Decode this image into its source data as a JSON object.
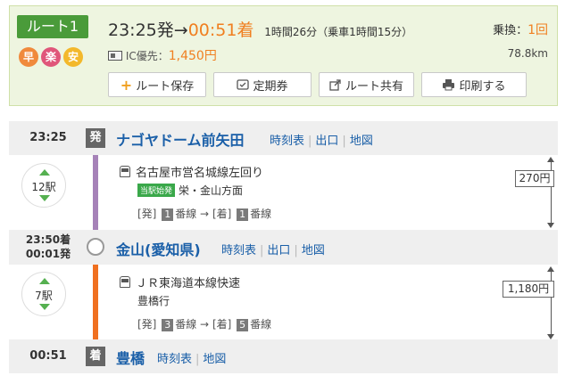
{
  "summary": {
    "route_label": "ルート1",
    "features": [
      "早",
      "楽",
      "安"
    ],
    "departure": "23:25発",
    "arrow": "→",
    "arrival": "00:51着",
    "duration": "1時間26分（乗車1時間15分）",
    "ic_label": "IC優先：",
    "fare": "1,450円",
    "transfer_label": "乗換：",
    "transfer_count": "1回",
    "distance": "78.8km",
    "buttons": {
      "save": "ルート保存",
      "commuter": "定期券",
      "share": "ルート共有",
      "print": "印刷する"
    }
  },
  "stations": [
    {
      "time": "23:25",
      "mark": "発",
      "name": "ナゴヤドーム前矢田",
      "links": [
        "時刻表",
        "出口",
        "地図"
      ]
    },
    {
      "time_arrive": "23:50着",
      "time_depart": "00:01発",
      "name": "金山(愛知県)",
      "links": [
        "時刻表",
        "出口",
        "地図"
      ]
    },
    {
      "time": "00:51",
      "mark": "着",
      "name": "豊橋",
      "links": [
        "時刻表",
        "地図"
      ]
    }
  ],
  "segments": [
    {
      "stops": "12駅",
      "line": "名古屋市営名城線左回り",
      "first_badge": "当駅始発",
      "direction": "栄・金山方面",
      "dep_label": "[発]",
      "dep_platform": "1",
      "arr_label": "[着]",
      "arr_platform": "1",
      "platform_suffix": "番線",
      "arrow": "→",
      "fare": "270円",
      "color": "#a682b8"
    },
    {
      "stops": "7駅",
      "line": "ＪＲ東海道本線快速",
      "direction": "豊橋行",
      "dep_label": "[発]",
      "dep_platform": "3",
      "arr_label": "[着]",
      "arr_platform": "5",
      "platform_suffix": "番線",
      "arrow": "→",
      "fare": "1,180円",
      "color": "#f07020"
    }
  ]
}
